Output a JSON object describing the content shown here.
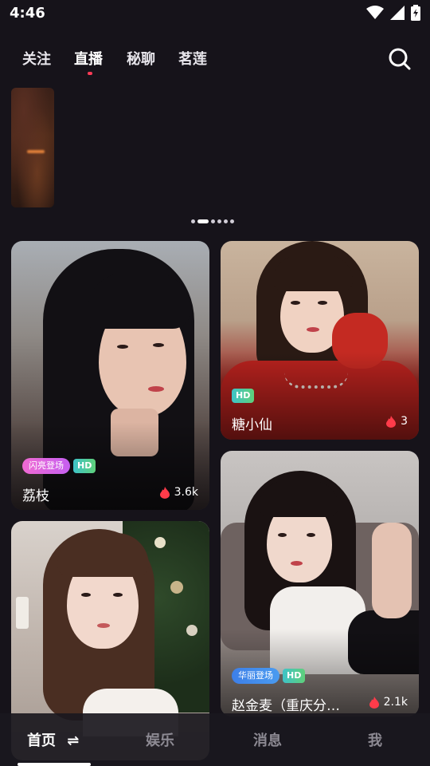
{
  "status_bar": {
    "time": "4:46"
  },
  "top_nav": {
    "tabs": [
      {
        "label": "关注"
      },
      {
        "label": "直播"
      },
      {
        "label": "秘聊"
      },
      {
        "label": "茗莲"
      }
    ],
    "active_tab": "直播"
  },
  "banner": {
    "page_count": 6,
    "active_page": 2
  },
  "cards": [
    {
      "name": "荔枝",
      "heat": "3.6k",
      "event_tag": "闪亮登场",
      "hd_tag": "HD"
    },
    {
      "name": "糖小仙",
      "heat": "3",
      "hd_tag": "HD"
    },
    {
      "name": "",
      "heat": ""
    },
    {
      "name": "赵金麦（重庆分…",
      "heat": "2.1k",
      "event_tag": "华丽登场",
      "hd_tag": "HD"
    }
  ],
  "bottom_nav": {
    "items": [
      {
        "label": "首页"
      },
      {
        "label": "娱乐"
      },
      {
        "label": "消息"
      },
      {
        "label": "我"
      }
    ],
    "refresh_icon": "⇌"
  },
  "colors": {
    "background": "#16131a",
    "accent": "#ff3b56",
    "event_tag_pink": "#e85cc8",
    "event_tag_blue": "#3d7fe8"
  }
}
